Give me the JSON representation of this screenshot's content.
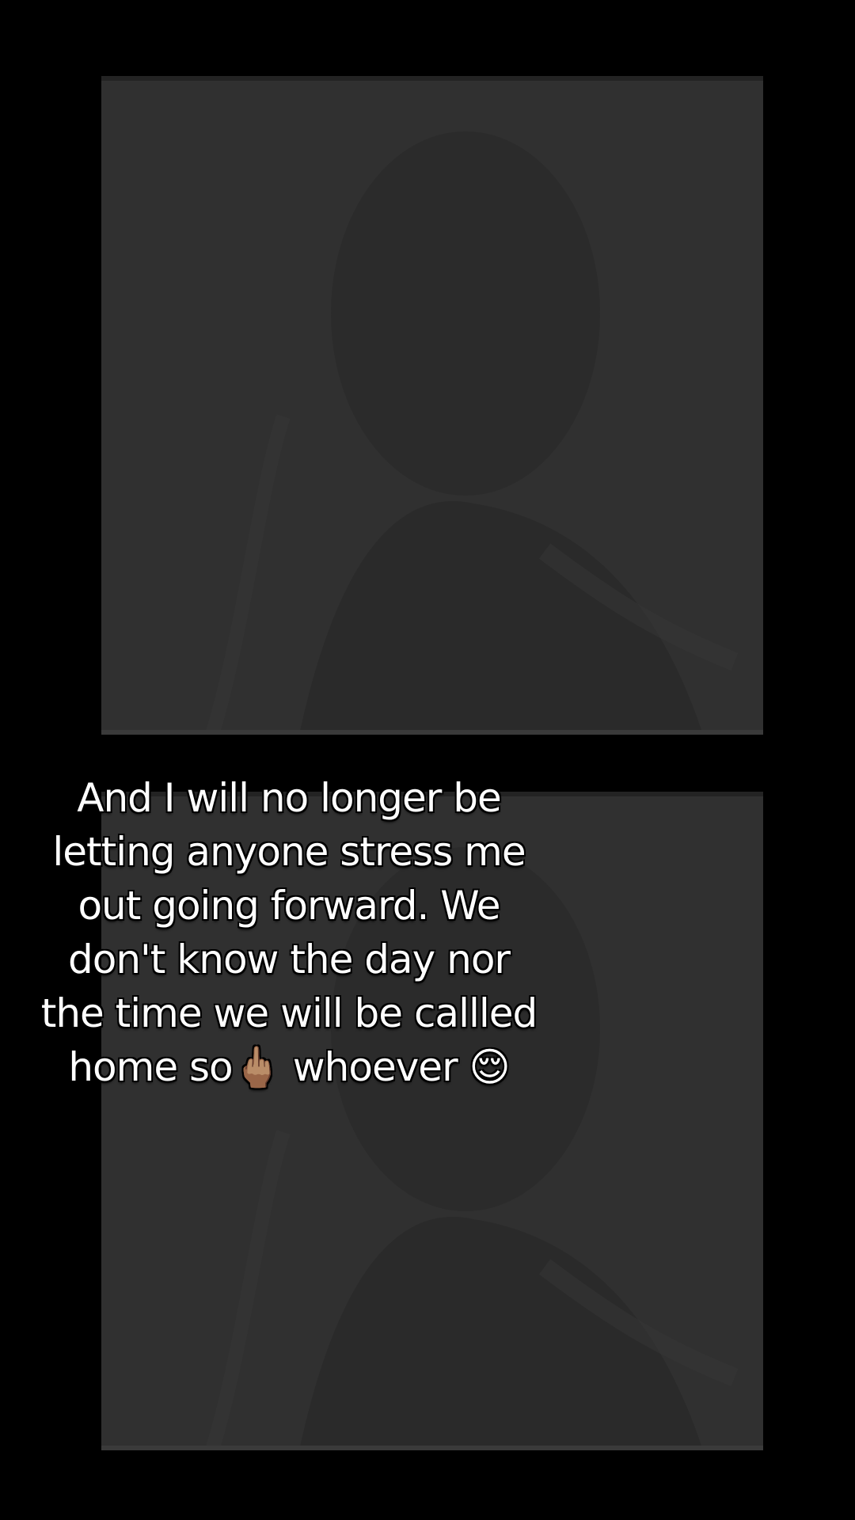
{
  "caption": {
    "lines": [
      "And I will no longer be",
      "letting anyone stress me",
      "out going forward. We",
      "don't know the day nor",
      "the time we will be callled",
      "home  so🖕🏽  whoever 😌"
    ]
  },
  "photos": [
    {
      "name": "top-photo",
      "tone": "dark-gray"
    },
    {
      "name": "bottom-photo",
      "tone": "dark-gray"
    }
  ],
  "colors": {
    "background": "#000000",
    "panel": "#2f2f2f",
    "text": "#ffffff"
  }
}
